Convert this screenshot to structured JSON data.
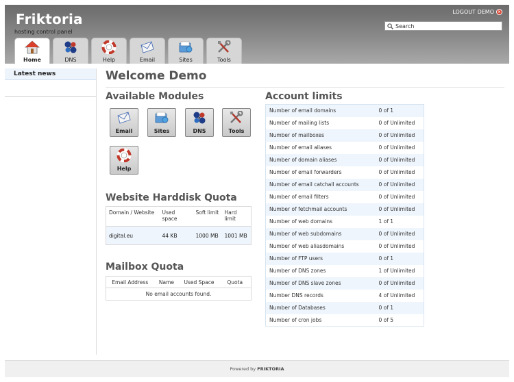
{
  "header": {
    "brand": "Friktoria",
    "tagline": "hosting control panel",
    "logout_label": "LOGOUT DEMO",
    "search_placeholder": "Search"
  },
  "tabs": [
    {
      "label": "Home",
      "icon": "home-icon"
    },
    {
      "label": "DNS",
      "icon": "dns-icon"
    },
    {
      "label": "Help",
      "icon": "help-lifebuoy-icon"
    },
    {
      "label": "Email",
      "icon": "email-icon"
    },
    {
      "label": "Sites",
      "icon": "sites-folder-icon"
    },
    {
      "label": "Tools",
      "icon": "tools-icon"
    }
  ],
  "sidebar": {
    "latest_news": "Latest news"
  },
  "main": {
    "welcome": "Welcome Demo",
    "modules_title": "Available Modules",
    "modules": [
      {
        "label": "Email",
        "icon": "email-icon"
      },
      {
        "label": "Sites",
        "icon": "sites-folder-icon"
      },
      {
        "label": "DNS",
        "icon": "dns-icon"
      },
      {
        "label": "Tools",
        "icon": "tools-icon"
      },
      {
        "label": "Help",
        "icon": "help-lifebuoy-icon"
      }
    ],
    "hdd_title": "Website Harddisk Quota",
    "hdd_headers": [
      "Domain / Website",
      "Used space",
      "Soft limit",
      "Hard limit"
    ],
    "hdd_rows": [
      [
        "digital.eu",
        "44 KB",
        "1000 MB",
        "1001 MB"
      ]
    ],
    "mail_title": "Mailbox Quota",
    "mail_headers": [
      "Email Address",
      "Name",
      "Used Space",
      "Quota"
    ],
    "mail_empty": "No email accounts found.",
    "limits_title": "Account limits",
    "limits": [
      [
        "Number of email domains",
        "0 of 1"
      ],
      [
        "Number of mailing lists",
        "0 of Unlimited"
      ],
      [
        "Number of mailboxes",
        "0 of Unlimited"
      ],
      [
        "Number of email aliases",
        "0 of Unlimited"
      ],
      [
        "Number of domain aliases",
        "0 of Unlimited"
      ],
      [
        "Number of email forwarders",
        "0 of Unlimited"
      ],
      [
        "Number of email catchall accounts",
        "0 of Unlimited"
      ],
      [
        "Number of email filters",
        "0 of Unlimited"
      ],
      [
        "Number of fetchmail accounts",
        "0 of Unlimited"
      ],
      [
        "Number of web domains",
        "1 of 1"
      ],
      [
        "Number of web subdomains",
        "0 of Unlimited"
      ],
      [
        "Number of web aliasdomains",
        "0 of Unlimited"
      ],
      [
        "Number of FTP users",
        "0 of 1"
      ],
      [
        "Number of DNS zones",
        "1 of Unlimited"
      ],
      [
        "Number of DNS slave zones",
        "0 of Unlimited"
      ],
      [
        "Number DNS records",
        "4 of Unlimited"
      ],
      [
        "Number of Databases",
        "0 of 1"
      ],
      [
        "Number of cron jobs",
        "0 of 5"
      ]
    ]
  },
  "footer": {
    "prefix": "Powered by",
    "brand": "FRIKTORIA"
  },
  "colors": {
    "header_dark": "#6b6b6b",
    "accent_row": "#eef5fc",
    "logout_dot": "#d43b2a"
  }
}
